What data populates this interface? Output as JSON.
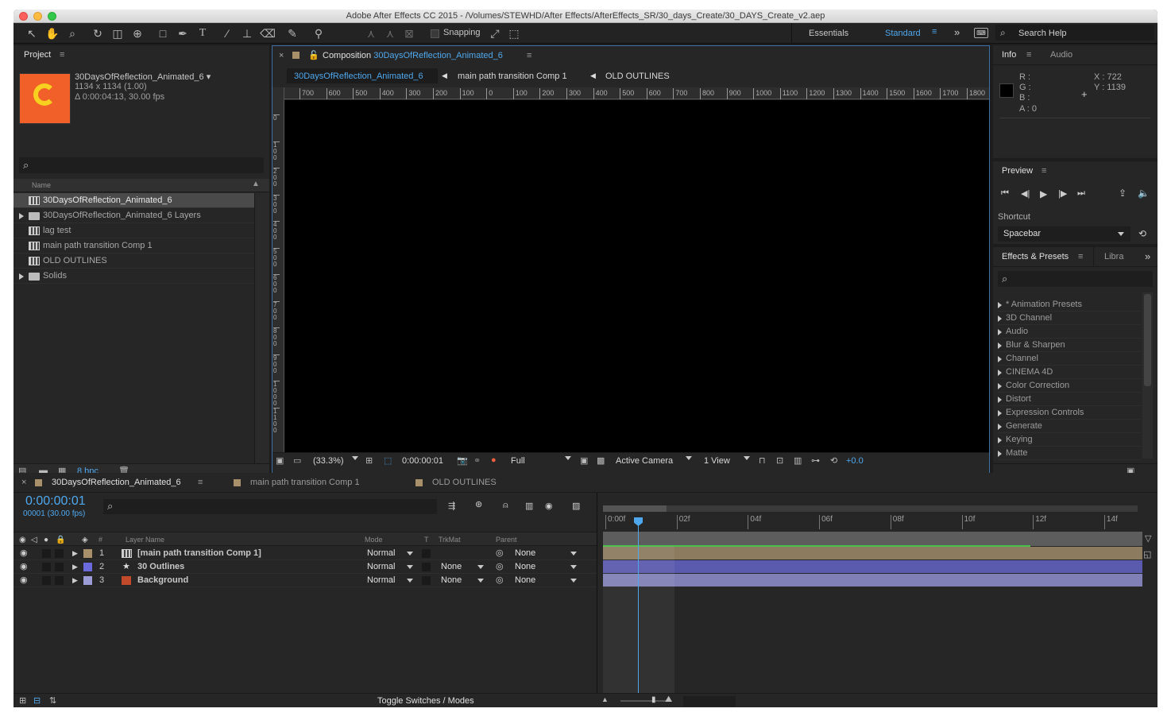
{
  "window": {
    "title": "Adobe After Effects CC 2015 - /Volumes/STEWHD/After Effects/AfterEffects_SR/30_days_Create/30_DAYS_Create_v2.aep"
  },
  "toolbar": {
    "snapping_label": "Snapping",
    "workspaces": [
      "Essentials",
      "Standard"
    ],
    "search_help": "Search Help"
  },
  "project": {
    "tab": "Project",
    "thumb_letter": "C",
    "item_name": "30DaysOfReflection_Animated_6 ▾",
    "dimensions": "1134 x 1134 (1.00)",
    "duration": "Δ 0:00:04:13, 30.00 fps",
    "search_icon": "⌕",
    "name_header": "Name",
    "items": [
      {
        "name": "30DaysOfReflection_Animated_6",
        "type": "comp",
        "expandable": false,
        "selected": true
      },
      {
        "name": "30DaysOfReflection_Animated_6 Layers",
        "type": "folder",
        "expandable": true,
        "selected": false
      },
      {
        "name": "lag test",
        "type": "comp",
        "expandable": false,
        "selected": false
      },
      {
        "name": "main path transition Comp 1",
        "type": "comp",
        "expandable": false,
        "selected": false
      },
      {
        "name": "OLD OUTLINES",
        "type": "comp",
        "expandable": false,
        "selected": false
      },
      {
        "name": "Solids",
        "type": "folder",
        "expandable": true,
        "selected": false
      }
    ],
    "bpc": "8 bpc"
  },
  "composition": {
    "tab_prefix": "Composition",
    "tab_name": "30DaysOfReflection_Animated_6",
    "breadcrumbs": [
      "30DaysOfReflection_Animated_6",
      "main path transition Comp 1",
      "OLD OUTLINES"
    ],
    "ruler_ticks": [
      "700",
      "600",
      "500",
      "400",
      "300",
      "200",
      "100",
      "0",
      "100",
      "200",
      "300",
      "400",
      "500",
      "600",
      "700",
      "800",
      "900",
      "1000",
      "1100",
      "1200",
      "1300",
      "1400",
      "1500",
      "1600",
      "1700",
      "1800"
    ],
    "vruler_ticks": [
      "0",
      "100",
      "200",
      "300",
      "400",
      "500",
      "600",
      "700",
      "800",
      "900",
      "1000",
      "1100"
    ],
    "zoom": "(33.3%)",
    "timecode": "0:00:00:01",
    "resolution": "Full",
    "camera": "Active Camera",
    "views": "1 View",
    "exposure": "+0.0"
  },
  "info": {
    "tabs": [
      "Info",
      "Audio"
    ],
    "r": "R :",
    "g": "G :",
    "b": "B :",
    "a": "A : 0",
    "x": "X : 722",
    "y": "Y : 1139"
  },
  "preview": {
    "tab": "Preview",
    "shortcut_label": "Shortcut",
    "shortcut_value": "Spacebar"
  },
  "effects": {
    "tabs": [
      "Effects & Presets",
      "Libra"
    ],
    "items": [
      "* Animation Presets",
      "3D Channel",
      "Audio",
      "Blur & Sharpen",
      "Channel",
      "CINEMA 4D",
      "Color Correction",
      "Distort",
      "Expression Controls",
      "Generate",
      "Keying",
      "Matte"
    ]
  },
  "timeline": {
    "tabs": [
      "30DaysOfReflection_Animated_6",
      "main path transition Comp 1",
      "OLD OUTLINES"
    ],
    "tab_colors": [
      "#a8906a",
      "#a8906a",
      "#a8906a"
    ],
    "timecode": "0:00:00:01",
    "frame_info": "00001 (30.00 fps)",
    "headers": {
      "num": "#",
      "layer_name": "Layer Name",
      "mode": "Mode",
      "t": "T",
      "trkmat": "TrkMat",
      "parent": "Parent"
    },
    "layers": [
      {
        "num": "1",
        "name": "[main path transition Comp 1]",
        "label_color": "#a8906a",
        "icon": "comp",
        "mode": "Normal",
        "trkmat": "",
        "parent": "None",
        "bar_color": "#8c7b5e"
      },
      {
        "num": "2",
        "name": "30 Outlines",
        "label_color": "#6a6adc",
        "icon": "shape",
        "mode": "Normal",
        "trkmat": "None",
        "parent": "None",
        "bar_color": "#5a5aae"
      },
      {
        "num": "3",
        "name": "Background",
        "label_color": "#9c9cd6",
        "icon": "solid",
        "mode": "Normal",
        "trkmat": "None",
        "parent": "None",
        "bar_color": "#8080b6"
      }
    ],
    "time_ticks": [
      "0:00f",
      "02f",
      "04f",
      "06f",
      "08f",
      "10f",
      "12f",
      "14f"
    ],
    "toggle_label": "Toggle Switches / Modes"
  }
}
